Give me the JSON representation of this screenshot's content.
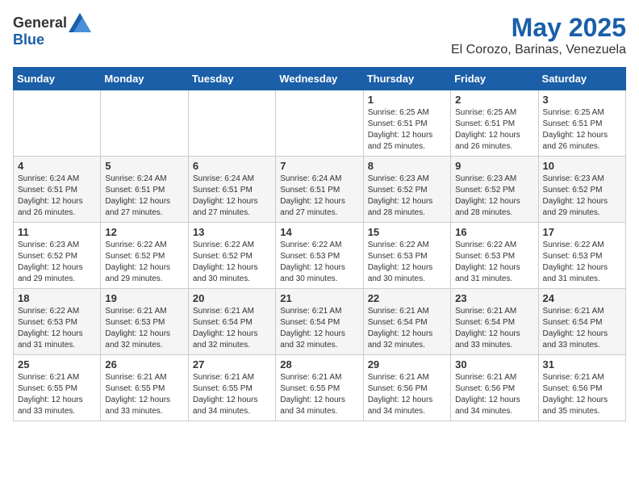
{
  "header": {
    "logo_general": "General",
    "logo_blue": "Blue",
    "title": "May 2025",
    "subtitle": "El Corozo, Barinas, Venezuela"
  },
  "days_of_week": [
    "Sunday",
    "Monday",
    "Tuesday",
    "Wednesday",
    "Thursday",
    "Friday",
    "Saturday"
  ],
  "weeks": [
    [
      {
        "day": "",
        "info": ""
      },
      {
        "day": "",
        "info": ""
      },
      {
        "day": "",
        "info": ""
      },
      {
        "day": "",
        "info": ""
      },
      {
        "day": "1",
        "info": "Sunrise: 6:25 AM\nSunset: 6:51 PM\nDaylight: 12 hours and 25 minutes."
      },
      {
        "day": "2",
        "info": "Sunrise: 6:25 AM\nSunset: 6:51 PM\nDaylight: 12 hours and 26 minutes."
      },
      {
        "day": "3",
        "info": "Sunrise: 6:25 AM\nSunset: 6:51 PM\nDaylight: 12 hours and 26 minutes."
      }
    ],
    [
      {
        "day": "4",
        "info": "Sunrise: 6:24 AM\nSunset: 6:51 PM\nDaylight: 12 hours and 26 minutes."
      },
      {
        "day": "5",
        "info": "Sunrise: 6:24 AM\nSunset: 6:51 PM\nDaylight: 12 hours and 27 minutes."
      },
      {
        "day": "6",
        "info": "Sunrise: 6:24 AM\nSunset: 6:51 PM\nDaylight: 12 hours and 27 minutes."
      },
      {
        "day": "7",
        "info": "Sunrise: 6:24 AM\nSunset: 6:51 PM\nDaylight: 12 hours and 27 minutes."
      },
      {
        "day": "8",
        "info": "Sunrise: 6:23 AM\nSunset: 6:52 PM\nDaylight: 12 hours and 28 minutes."
      },
      {
        "day": "9",
        "info": "Sunrise: 6:23 AM\nSunset: 6:52 PM\nDaylight: 12 hours and 28 minutes."
      },
      {
        "day": "10",
        "info": "Sunrise: 6:23 AM\nSunset: 6:52 PM\nDaylight: 12 hours and 29 minutes."
      }
    ],
    [
      {
        "day": "11",
        "info": "Sunrise: 6:23 AM\nSunset: 6:52 PM\nDaylight: 12 hours and 29 minutes."
      },
      {
        "day": "12",
        "info": "Sunrise: 6:22 AM\nSunset: 6:52 PM\nDaylight: 12 hours and 29 minutes."
      },
      {
        "day": "13",
        "info": "Sunrise: 6:22 AM\nSunset: 6:52 PM\nDaylight: 12 hours and 30 minutes."
      },
      {
        "day": "14",
        "info": "Sunrise: 6:22 AM\nSunset: 6:53 PM\nDaylight: 12 hours and 30 minutes."
      },
      {
        "day": "15",
        "info": "Sunrise: 6:22 AM\nSunset: 6:53 PM\nDaylight: 12 hours and 30 minutes."
      },
      {
        "day": "16",
        "info": "Sunrise: 6:22 AM\nSunset: 6:53 PM\nDaylight: 12 hours and 31 minutes."
      },
      {
        "day": "17",
        "info": "Sunrise: 6:22 AM\nSunset: 6:53 PM\nDaylight: 12 hours and 31 minutes."
      }
    ],
    [
      {
        "day": "18",
        "info": "Sunrise: 6:22 AM\nSunset: 6:53 PM\nDaylight: 12 hours and 31 minutes."
      },
      {
        "day": "19",
        "info": "Sunrise: 6:21 AM\nSunset: 6:53 PM\nDaylight: 12 hours and 32 minutes."
      },
      {
        "day": "20",
        "info": "Sunrise: 6:21 AM\nSunset: 6:54 PM\nDaylight: 12 hours and 32 minutes."
      },
      {
        "day": "21",
        "info": "Sunrise: 6:21 AM\nSunset: 6:54 PM\nDaylight: 12 hours and 32 minutes."
      },
      {
        "day": "22",
        "info": "Sunrise: 6:21 AM\nSunset: 6:54 PM\nDaylight: 12 hours and 32 minutes."
      },
      {
        "day": "23",
        "info": "Sunrise: 6:21 AM\nSunset: 6:54 PM\nDaylight: 12 hours and 33 minutes."
      },
      {
        "day": "24",
        "info": "Sunrise: 6:21 AM\nSunset: 6:54 PM\nDaylight: 12 hours and 33 minutes."
      }
    ],
    [
      {
        "day": "25",
        "info": "Sunrise: 6:21 AM\nSunset: 6:55 PM\nDaylight: 12 hours and 33 minutes."
      },
      {
        "day": "26",
        "info": "Sunrise: 6:21 AM\nSunset: 6:55 PM\nDaylight: 12 hours and 33 minutes."
      },
      {
        "day": "27",
        "info": "Sunrise: 6:21 AM\nSunset: 6:55 PM\nDaylight: 12 hours and 34 minutes."
      },
      {
        "day": "28",
        "info": "Sunrise: 6:21 AM\nSunset: 6:55 PM\nDaylight: 12 hours and 34 minutes."
      },
      {
        "day": "29",
        "info": "Sunrise: 6:21 AM\nSunset: 6:56 PM\nDaylight: 12 hours and 34 minutes."
      },
      {
        "day": "30",
        "info": "Sunrise: 6:21 AM\nSunset: 6:56 PM\nDaylight: 12 hours and 34 minutes."
      },
      {
        "day": "31",
        "info": "Sunrise: 6:21 AM\nSunset: 6:56 PM\nDaylight: 12 hours and 35 minutes."
      }
    ]
  ]
}
